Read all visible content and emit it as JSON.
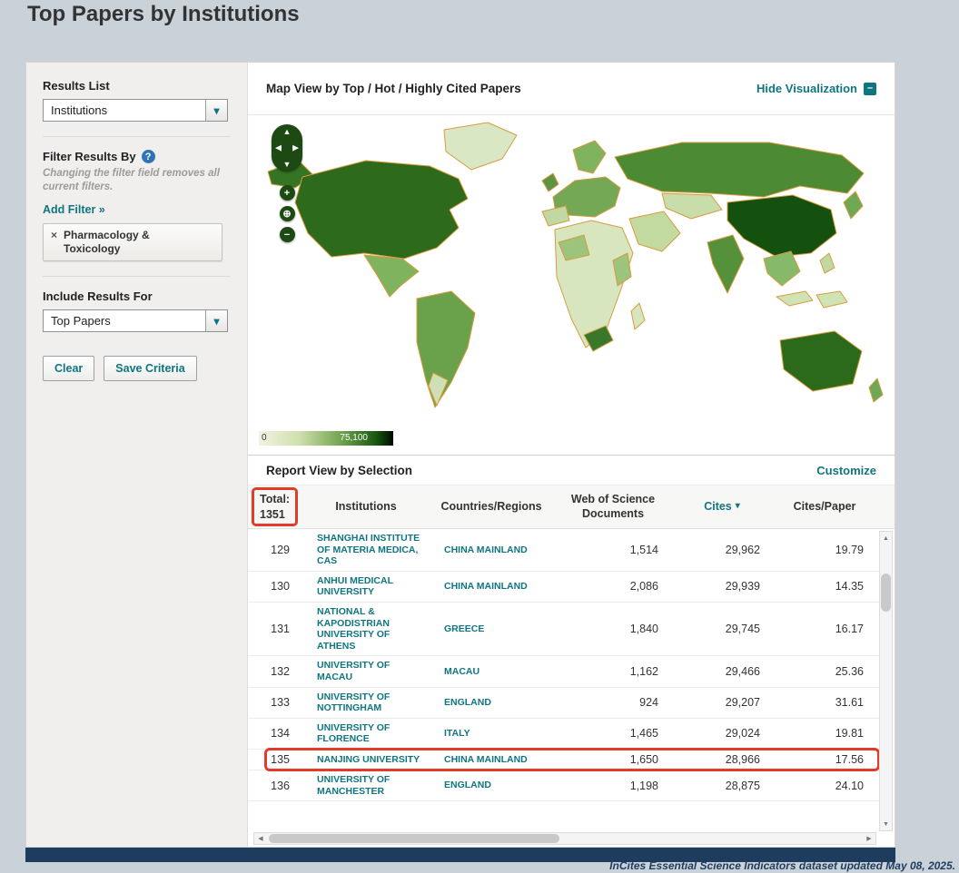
{
  "page": {
    "title": "Top Papers by Institutions",
    "footer_note": "InCites Essential Science Indicators dataset updated May 08, 2025."
  },
  "colors": {
    "accent_teal": "#0f7580",
    "annotation_red": "#e23b2a",
    "choropleth_min": "#f4f1e2",
    "choropleth_max": "#000000",
    "footer_bar": "#1e3c5e"
  },
  "icons": {
    "chevron_down": "▾",
    "help": "?",
    "remove": "×",
    "sort_desc": "▾",
    "collapse_minus": "–",
    "pan_up": "▲",
    "pan_down": "▼",
    "pan_left": "◀",
    "pan_right": "▶",
    "zoom_in": "+",
    "zoom_out": "−",
    "globe": "⊕",
    "scroll_up": "▲",
    "scroll_down": "▼",
    "scroll_left": "◀",
    "scroll_right": "▶"
  },
  "sidebar": {
    "results_list_label": "Results List",
    "results_list_value": "Institutions",
    "filter_by_label": "Filter Results By",
    "filter_note": "Changing the filter field removes all current filters.",
    "add_filter_label": "Add Filter »",
    "filter_chip_label": "Pharmacology & Toxicology",
    "include_label": "Include Results For",
    "include_value": "Top Papers",
    "clear_button": "Clear",
    "save_button": "Save Criteria"
  },
  "map": {
    "title": "Map View by Top / Hot / Highly Cited Papers",
    "hide_label": "Hide Visualization",
    "scale_min": "0",
    "scale_max": "75,100"
  },
  "report": {
    "title": "Report View by Selection",
    "customize_label": "Customize",
    "total_label": "Total:",
    "total_value": "1351",
    "col_institutions": "Institutions",
    "col_countries": "Countries/Regions",
    "col_docs": "Web of Science Documents",
    "col_cites": "Cites",
    "col_cites_paper": "Cites/Paper",
    "rows": [
      {
        "rank": "129",
        "institution": "SHANGHAI INSTITUTE OF MATERIA MEDICA, CAS",
        "country": "CHINA MAINLAND",
        "docs": "1,514",
        "cites": "29,962",
        "cites_per_paper": "19.79"
      },
      {
        "rank": "130",
        "institution": "ANHUI MEDICAL UNIVERSITY",
        "country": "CHINA MAINLAND",
        "docs": "2,086",
        "cites": "29,939",
        "cites_per_paper": "14.35"
      },
      {
        "rank": "131",
        "institution": "NATIONAL & KAPODISTRIAN UNIVERSITY OF ATHENS",
        "country": "GREECE",
        "docs": "1,840",
        "cites": "29,745",
        "cites_per_paper": "16.17"
      },
      {
        "rank": "132",
        "institution": "UNIVERSITY OF MACAU",
        "country": "MACAU",
        "docs": "1,162",
        "cites": "29,466",
        "cites_per_paper": "25.36"
      },
      {
        "rank": "133",
        "institution": "UNIVERSITY OF NOTTINGHAM",
        "country": "ENGLAND",
        "docs": "924",
        "cites": "29,207",
        "cites_per_paper": "31.61"
      },
      {
        "rank": "134",
        "institution": "UNIVERSITY OF FLORENCE",
        "country": "ITALY",
        "docs": "1,465",
        "cites": "29,024",
        "cites_per_paper": "19.81"
      },
      {
        "rank": "135",
        "institution": "NANJING UNIVERSITY",
        "country": "CHINA MAINLAND",
        "docs": "1,650",
        "cites": "28,966",
        "cites_per_paper": "17.56"
      },
      {
        "rank": "136",
        "institution": "UNIVERSITY OF MANCHESTER",
        "country": "ENGLAND",
        "docs": "1,198",
        "cites": "28,875",
        "cites_per_paper": "24.10"
      }
    ]
  }
}
